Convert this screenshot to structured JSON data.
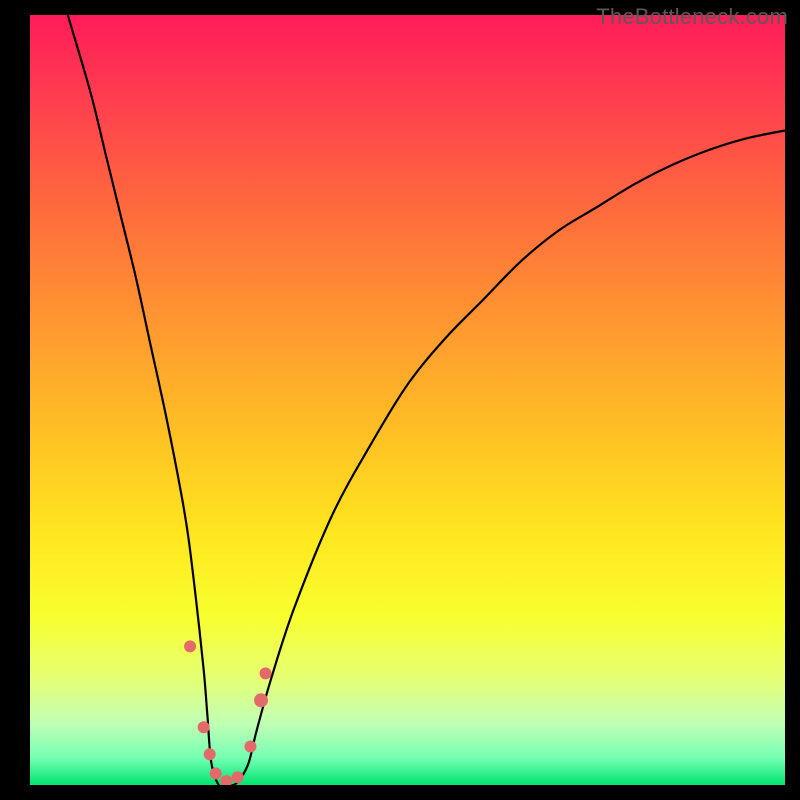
{
  "watermark": "TheBottleneck.com",
  "chart_data": {
    "type": "line",
    "title": "",
    "xlabel": "",
    "ylabel": "",
    "xlim": [
      0,
      100
    ],
    "ylim": [
      0,
      100
    ],
    "grid": false,
    "legend": false,
    "background_gradient_stops": [
      {
        "offset": 0.0,
        "color": "#ff1c58"
      },
      {
        "offset": 0.1,
        "color": "#ff3b50"
      },
      {
        "offset": 0.25,
        "color": "#ff6a3d"
      },
      {
        "offset": 0.4,
        "color": "#ff9730"
      },
      {
        "offset": 0.55,
        "color": "#ffc223"
      },
      {
        "offset": 0.68,
        "color": "#ffe81f"
      },
      {
        "offset": 0.78,
        "color": "#f8ff2e"
      },
      {
        "offset": 0.86,
        "color": "#e6ff72"
      },
      {
        "offset": 0.92,
        "color": "#c1ffb4"
      },
      {
        "offset": 0.965,
        "color": "#74ffb3"
      },
      {
        "offset": 1.0,
        "color": "#00e56f"
      }
    ],
    "series": [
      {
        "name": "bottleneck-curve",
        "x": [
          5,
          8,
          10,
          12,
          14,
          16,
          18,
          20,
          21,
          22,
          23,
          23.5,
          24,
          25,
          26,
          27,
          28,
          29,
          30,
          32,
          35,
          40,
          45,
          50,
          55,
          60,
          65,
          70,
          75,
          80,
          85,
          90,
          95,
          100
        ],
        "y": [
          100,
          90,
          82,
          74,
          66,
          57,
          48,
          38,
          32,
          24,
          15,
          9,
          3,
          0,
          0,
          0,
          1,
          3,
          7,
          14,
          23,
          35,
          44,
          52,
          58,
          63,
          68,
          72,
          75,
          78,
          80.5,
          82.5,
          84,
          85
        ]
      }
    ],
    "markers": [
      {
        "x": 21.2,
        "y": 18.0,
        "r": 6
      },
      {
        "x": 23.0,
        "y": 7.5,
        "r": 6
      },
      {
        "x": 23.8,
        "y": 4.0,
        "r": 6
      },
      {
        "x": 24.6,
        "y": 1.5,
        "r": 6
      },
      {
        "x": 26.0,
        "y": 0.5,
        "r": 6
      },
      {
        "x": 27.5,
        "y": 1.0,
        "r": 6
      },
      {
        "x": 29.2,
        "y": 5.0,
        "r": 6
      },
      {
        "x": 30.6,
        "y": 11.0,
        "r": 7
      },
      {
        "x": 31.2,
        "y": 14.5,
        "r": 6
      }
    ],
    "marker_color": "#e46a6a"
  }
}
